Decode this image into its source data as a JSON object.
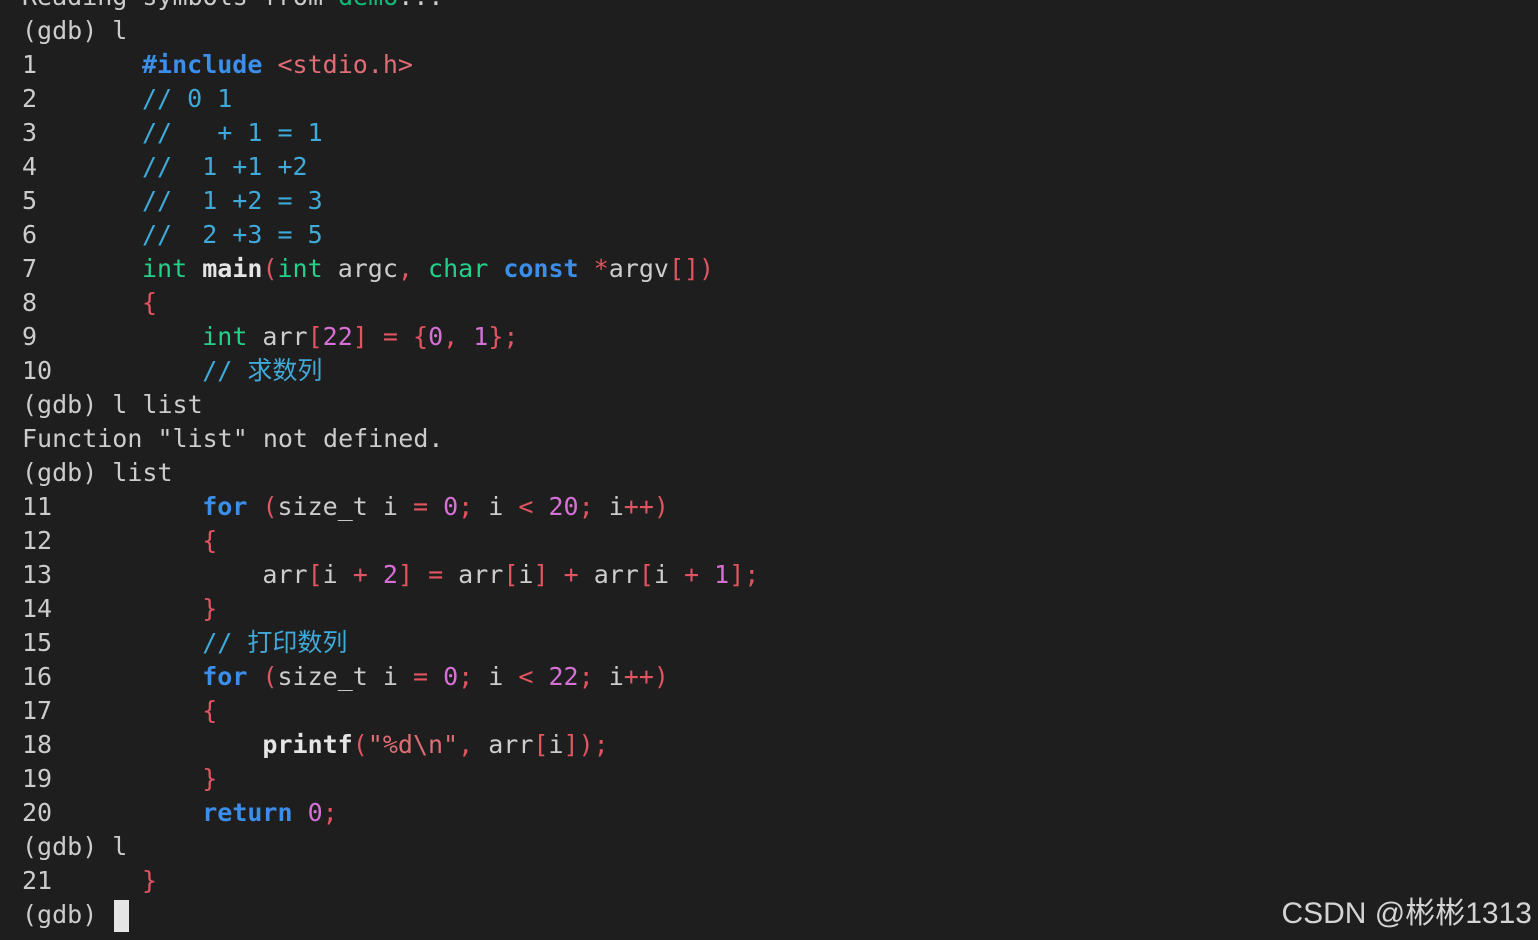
{
  "terminal": {
    "lines": [
      {
        "num": "",
        "tokens": [
          {
            "t": "Reading symbols from ",
            "c": "default"
          },
          {
            "t": "demo",
            "c": "dim"
          },
          {
            "t": "...",
            "c": "default"
          }
        ]
      },
      {
        "num": "",
        "tokens": [
          {
            "t": "(gdb) l",
            "c": "default"
          }
        ]
      },
      {
        "num": "1",
        "tokens": [
          {
            "t": "#include",
            "c": "dir"
          },
          {
            "t": " ",
            "c": "default"
          },
          {
            "t": "<stdio.h>",
            "c": "hdr"
          }
        ]
      },
      {
        "num": "2",
        "tokens": [
          {
            "t": "// 0 1",
            "c": "comment"
          }
        ]
      },
      {
        "num": "3",
        "tokens": [
          {
            "t": "//   + 1 = 1",
            "c": "comment"
          }
        ]
      },
      {
        "num": "4",
        "tokens": [
          {
            "t": "//  1 +1 +2",
            "c": "comment"
          }
        ]
      },
      {
        "num": "5",
        "tokens": [
          {
            "t": "//  1 +2 = 3",
            "c": "comment"
          }
        ]
      },
      {
        "num": "6",
        "tokens": [
          {
            "t": "//  2 +3 = 5",
            "c": "comment"
          }
        ]
      },
      {
        "num": "7",
        "tokens": [
          {
            "t": "int",
            "c": "type"
          },
          {
            "t": " ",
            "c": "default"
          },
          {
            "t": "main",
            "c": "func"
          },
          {
            "t": "(",
            "c": "punct"
          },
          {
            "t": "int",
            "c": "type"
          },
          {
            "t": " argc",
            "c": "default"
          },
          {
            "t": ",",
            "c": "punct"
          },
          {
            "t": " ",
            "c": "default"
          },
          {
            "t": "char",
            "c": "type"
          },
          {
            "t": " ",
            "c": "default"
          },
          {
            "t": "const",
            "c": "kw"
          },
          {
            "t": " ",
            "c": "default"
          },
          {
            "t": "*",
            "c": "punct"
          },
          {
            "t": "argv",
            "c": "default"
          },
          {
            "t": "[])",
            "c": "punct"
          }
        ]
      },
      {
        "num": "8",
        "tokens": [
          {
            "t": "{",
            "c": "punct"
          }
        ]
      },
      {
        "num": "9",
        "tokens": [
          {
            "t": "    ",
            "c": "default"
          },
          {
            "t": "int",
            "c": "type"
          },
          {
            "t": " arr",
            "c": "default"
          },
          {
            "t": "[",
            "c": "punct"
          },
          {
            "t": "22",
            "c": "num"
          },
          {
            "t": "]",
            "c": "punct"
          },
          {
            "t": " ",
            "c": "default"
          },
          {
            "t": "=",
            "c": "punct"
          },
          {
            "t": " ",
            "c": "default"
          },
          {
            "t": "{",
            "c": "punct"
          },
          {
            "t": "0",
            "c": "num"
          },
          {
            "t": ",",
            "c": "punct"
          },
          {
            "t": " ",
            "c": "default"
          },
          {
            "t": "1",
            "c": "num"
          },
          {
            "t": "};",
            "c": "punct"
          }
        ]
      },
      {
        "num": "10",
        "tokens": [
          {
            "t": "    // 求数列",
            "c": "comment"
          }
        ]
      },
      {
        "num": "",
        "tokens": [
          {
            "t": "(gdb) l list",
            "c": "default"
          }
        ]
      },
      {
        "num": "",
        "tokens": [
          {
            "t": "Function \"list\" not defined.",
            "c": "default"
          }
        ]
      },
      {
        "num": "",
        "tokens": [
          {
            "t": "(gdb) list",
            "c": "default"
          }
        ]
      },
      {
        "num": "11",
        "tokens": [
          {
            "t": "    ",
            "c": "default"
          },
          {
            "t": "for",
            "c": "kw"
          },
          {
            "t": " ",
            "c": "default"
          },
          {
            "t": "(",
            "c": "punct"
          },
          {
            "t": "size_t i ",
            "c": "default"
          },
          {
            "t": "=",
            "c": "punct"
          },
          {
            "t": " ",
            "c": "default"
          },
          {
            "t": "0",
            "c": "num"
          },
          {
            "t": ";",
            "c": "punct"
          },
          {
            "t": " i ",
            "c": "default"
          },
          {
            "t": "<",
            "c": "punct"
          },
          {
            "t": " ",
            "c": "default"
          },
          {
            "t": "20",
            "c": "num"
          },
          {
            "t": ";",
            "c": "punct"
          },
          {
            "t": " i",
            "c": "default"
          },
          {
            "t": "++)",
            "c": "punct"
          }
        ]
      },
      {
        "num": "12",
        "tokens": [
          {
            "t": "    ",
            "c": "default"
          },
          {
            "t": "{",
            "c": "punct"
          }
        ]
      },
      {
        "num": "13",
        "tokens": [
          {
            "t": "        arr",
            "c": "default"
          },
          {
            "t": "[",
            "c": "punct"
          },
          {
            "t": "i ",
            "c": "default"
          },
          {
            "t": "+",
            "c": "punct"
          },
          {
            "t": " ",
            "c": "default"
          },
          {
            "t": "2",
            "c": "num"
          },
          {
            "t": "]",
            "c": "punct"
          },
          {
            "t": " ",
            "c": "default"
          },
          {
            "t": "=",
            "c": "punct"
          },
          {
            "t": " arr",
            "c": "default"
          },
          {
            "t": "[",
            "c": "punct"
          },
          {
            "t": "i",
            "c": "default"
          },
          {
            "t": "]",
            "c": "punct"
          },
          {
            "t": " ",
            "c": "default"
          },
          {
            "t": "+",
            "c": "punct"
          },
          {
            "t": " arr",
            "c": "default"
          },
          {
            "t": "[",
            "c": "punct"
          },
          {
            "t": "i ",
            "c": "default"
          },
          {
            "t": "+",
            "c": "punct"
          },
          {
            "t": " ",
            "c": "default"
          },
          {
            "t": "1",
            "c": "num"
          },
          {
            "t": "];",
            "c": "punct"
          }
        ]
      },
      {
        "num": "14",
        "tokens": [
          {
            "t": "    ",
            "c": "default"
          },
          {
            "t": "}",
            "c": "punct"
          }
        ]
      },
      {
        "num": "15",
        "tokens": [
          {
            "t": "    // 打印数列",
            "c": "comment"
          }
        ]
      },
      {
        "num": "16",
        "tokens": [
          {
            "t": "    ",
            "c": "default"
          },
          {
            "t": "for",
            "c": "kw"
          },
          {
            "t": " ",
            "c": "default"
          },
          {
            "t": "(",
            "c": "punct"
          },
          {
            "t": "size_t i ",
            "c": "default"
          },
          {
            "t": "=",
            "c": "punct"
          },
          {
            "t": " ",
            "c": "default"
          },
          {
            "t": "0",
            "c": "num"
          },
          {
            "t": ";",
            "c": "punct"
          },
          {
            "t": " i ",
            "c": "default"
          },
          {
            "t": "<",
            "c": "punct"
          },
          {
            "t": " ",
            "c": "default"
          },
          {
            "t": "22",
            "c": "num"
          },
          {
            "t": ";",
            "c": "punct"
          },
          {
            "t": " i",
            "c": "default"
          },
          {
            "t": "++)",
            "c": "punct"
          }
        ]
      },
      {
        "num": "17",
        "tokens": [
          {
            "t": "    ",
            "c": "default"
          },
          {
            "t": "{",
            "c": "punct"
          }
        ]
      },
      {
        "num": "18",
        "tokens": [
          {
            "t": "        ",
            "c": "default"
          },
          {
            "t": "printf",
            "c": "func"
          },
          {
            "t": "(",
            "c": "punct"
          },
          {
            "t": "\"%d\\n\"",
            "c": "str"
          },
          {
            "t": ",",
            "c": "punct"
          },
          {
            "t": " arr",
            "c": "default"
          },
          {
            "t": "[",
            "c": "punct"
          },
          {
            "t": "i",
            "c": "default"
          },
          {
            "t": "]);",
            "c": "punct"
          }
        ]
      },
      {
        "num": "19",
        "tokens": [
          {
            "t": "    ",
            "c": "default"
          },
          {
            "t": "}",
            "c": "punct"
          }
        ]
      },
      {
        "num": "20",
        "tokens": [
          {
            "t": "    ",
            "c": "default"
          },
          {
            "t": "return",
            "c": "kw"
          },
          {
            "t": " ",
            "c": "default"
          },
          {
            "t": "0",
            "c": "num"
          },
          {
            "t": ";",
            "c": "punct"
          }
        ]
      },
      {
        "num": "",
        "tokens": [
          {
            "t": "(gdb) l",
            "c": "default"
          }
        ]
      },
      {
        "num": "21",
        "tokens": [
          {
            "t": "}",
            "c": "punct"
          }
        ]
      }
    ],
    "prompt": "(gdb) "
  },
  "watermark": "CSDN @彬彬1313",
  "colors": {
    "background": "#1e1e1e",
    "foreground": "#cccccc",
    "keyword": "#3b8eea",
    "type": "#23d18b",
    "comment": "#3fa9d8",
    "punctuation": "#e05561",
    "number": "#d670d6"
  }
}
